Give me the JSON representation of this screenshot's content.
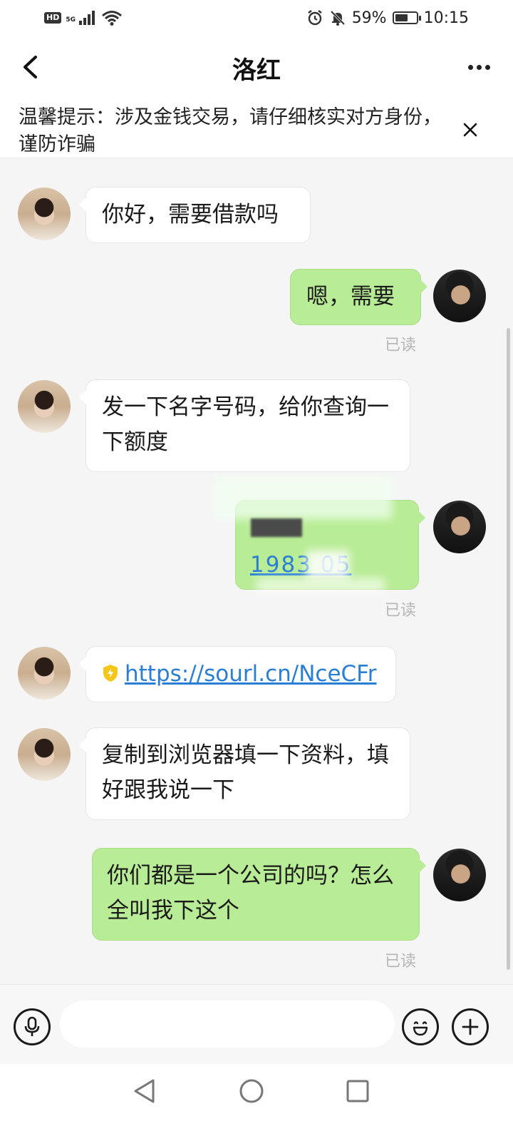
{
  "status_bar": {
    "hd": "HD",
    "network": "5G",
    "battery_percent": "59%",
    "battery_level": 0.59,
    "time": "10:15"
  },
  "header": {
    "title": "洛红",
    "back_icon": "chevron-left-icon",
    "more_icon": "more-horizontal-icon"
  },
  "notice": {
    "text": "温馨提示：涉及金钱交易，请仔细核实对方身份，谨防诈骗",
    "close_icon": "close-icon"
  },
  "messages": [
    {
      "side": "in",
      "text": "你好，需要借款吗"
    },
    {
      "side": "out",
      "text": "嗯，需要",
      "status": "已读"
    },
    {
      "side": "in",
      "text": "发一下名字号码，给你查询一下额度"
    },
    {
      "side": "out",
      "text": "1983 05",
      "status": "已读",
      "obscured": true
    },
    {
      "side": "in",
      "link": "https://sourl.cn/NceCFr",
      "icon": "shield-bolt-icon"
    },
    {
      "side": "in",
      "text": "复制到浏览器填一下资料，填好跟我说一下"
    },
    {
      "side": "out",
      "text": "你们都是一个公司的吗？怎么全叫我下这个",
      "status": "已读"
    }
  ],
  "input_bar": {
    "placeholder": "",
    "voice_icon": "microphone-icon",
    "emoji_icon": "emoji-icon",
    "add_icon": "plus-icon"
  },
  "nav_bar": {
    "back_icon": "nav-back-icon",
    "home_icon": "nav-home-icon",
    "recents_icon": "nav-recents-icon"
  },
  "colors": {
    "bubble_out": "#b9ec96",
    "bubble_in": "#ffffff",
    "link": "#2a7fd4",
    "shield": "#f5c518",
    "read": "#b5b5b5"
  }
}
